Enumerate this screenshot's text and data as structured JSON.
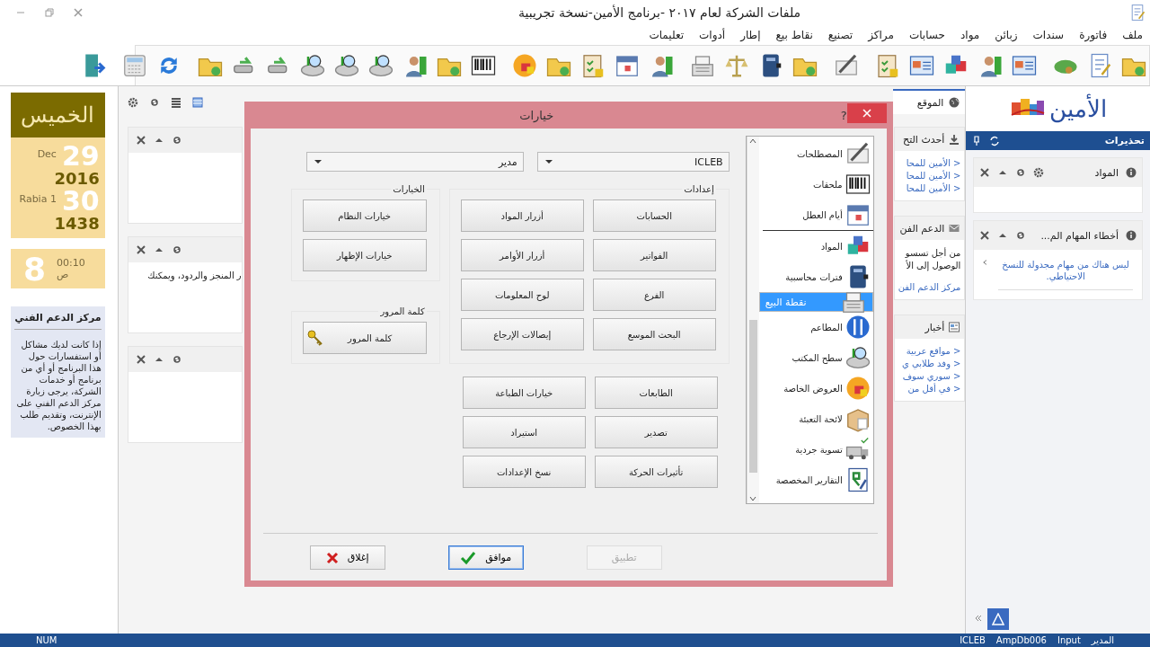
{
  "window": {
    "title": "ملفات الشركة لعام ٢٠١٧ -برنامج الأمين-نسخة تجريبية"
  },
  "menu": [
    "ملف",
    "فاتورة",
    "سندات",
    "زبائن",
    "مواد",
    "حسابات",
    "مراكز",
    "تصنيع",
    "نقاط بيع",
    "إطار",
    "أدوات",
    "تعليمات"
  ],
  "date_widget": {
    "day": "الخميس",
    "gregorian": {
      "month": "Dec",
      "day": "29",
      "year": "2016"
    },
    "hijri": {
      "month": "Rabia 1",
      "day": "30",
      "year": "1438"
    },
    "time": {
      "hour": "8",
      "minutes": "00:10",
      "period": "ص"
    }
  },
  "support_box": {
    "title": "مركز الدعم الفني",
    "text": "إذا كانت لديك مشاكل أو استفسارات حول هذا البرنامج أو أي من برنامج أو خدمات الشركة، يرجى زيارة مركز الدعم الفني على الإنترنت، وتقديم طلب بهذا الخصوص."
  },
  "dashboard": {
    "left_panels": [
      {
        "kind": "empty"
      },
      {
        "kind": "text",
        "text": "ر المنجز والردود، ويمكنك"
      },
      {
        "kind": "empty"
      }
    ],
    "site_tab": {
      "label": "الموقع"
    },
    "right_panels": [
      {
        "kind": "links",
        "title": "أحدث التح",
        "links": [
          {
            "bullet": ">",
            "text": "الأمين للمحا"
          },
          {
            "bullet": ">",
            "text": "الأمين للمحا"
          },
          {
            "bullet": ">",
            "text": "الأمين للمحا"
          }
        ]
      },
      {
        "kind": "text",
        "title": "الدعم الفن",
        "lines": [
          "من أجل تسسو",
          "الوصول إلى الأ"
        ],
        "link": "مركز الدعم الفن"
      },
      {
        "kind": "links",
        "title": "أخبار",
        "links": [
          {
            "bullet": ">",
            "text": "مواقع عربية"
          },
          {
            "bullet": ">",
            "text": "وفد طلابي ي"
          },
          {
            "bullet": ">",
            "text": "سوري سوف"
          },
          {
            "bullet": ">",
            "text": "في أقل من"
          }
        ]
      }
    ]
  },
  "sidebar": {
    "logo": "الأمين",
    "header": "تحذيرات",
    "panels": [
      {
        "title": "المواد",
        "settings": true
      },
      {
        "title": "أخطاء المهام الم...",
        "settings": false,
        "link": "ليس هناك من مهام مجدولة للنسخ الاحتياطي."
      }
    ]
  },
  "dialog": {
    "title": "خيارات",
    "help": "?",
    "category_groups": [
      [
        {
          "label": "المصطلحات",
          "selected": false
        },
        {
          "label": "ملحقات",
          "selected": false
        },
        {
          "label": "أيام العطل",
          "selected": false
        }
      ],
      [
        {
          "label": "المواد",
          "selected": false
        },
        {
          "label": "فترات محاسبية",
          "selected": false
        },
        {
          "label": "نقطة البيع",
          "selected": true
        },
        {
          "label": "المطاعم",
          "selected": false
        },
        {
          "label": "سطح المكتب",
          "selected": false
        },
        {
          "label": "العروض الخاصة",
          "selected": false
        },
        {
          "label": "لائحة التعبئة",
          "selected": false
        },
        {
          "label": "تسوية جردية",
          "selected": false
        },
        {
          "label": "التقارير المخصصة",
          "selected": false
        }
      ]
    ],
    "selectors": [
      {
        "value": "ICLEB"
      },
      {
        "value": "مدير"
      }
    ],
    "settings": {
      "title": "إعدادات",
      "buttons": [
        "الحسابات",
        "أزرار المواد",
        "الفواتير",
        "أزرار الأوامر",
        "الفرع",
        "لوح المعلومات",
        "البحث الموسع",
        "إيصالات الإرجاع"
      ]
    },
    "options": {
      "title": "الخيارات",
      "buttons": [
        "خيارات النظام",
        "خيارات الإظهار"
      ]
    },
    "password": {
      "title": "كلمة المرور",
      "button": "كلمة المرور"
    },
    "more_buttons": [
      "الطابعات",
      "خيارات الطباعة",
      "تصدير",
      "استيراد",
      "تأثيرات الحركة",
      "نسخ الإعدادات"
    ],
    "footer": [
      {
        "label": "تطبيق",
        "kind": "apply",
        "disabled": true,
        "focused": false
      },
      {
        "label": "موافق",
        "kind": "ok",
        "disabled": false,
        "focused": true
      },
      {
        "label": "إغلاق",
        "kind": "close",
        "disabled": false,
        "focused": false
      }
    ]
  },
  "status_bar": {
    "left": "NUM",
    "right": [
      "المدير",
      "Input",
      "AmpDb006",
      "ICLEB"
    ]
  }
}
